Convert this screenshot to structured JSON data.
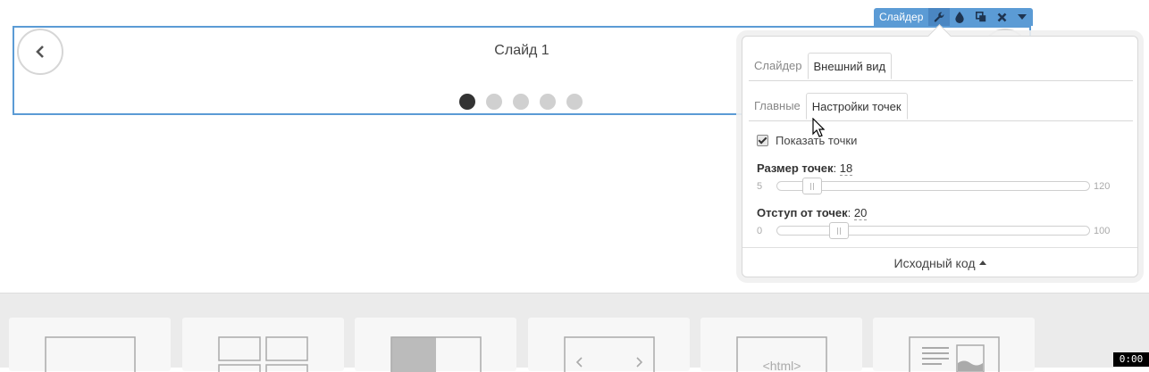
{
  "slider": {
    "toolbar_label": "Слайдер",
    "toolbar_icons": [
      "wrench-icon",
      "drop-icon",
      "duplicate-icon",
      "close-icon",
      "caret-down-icon"
    ],
    "slide_title": "Слайд 1",
    "dots_count": 5,
    "active_dot": 1,
    "accent_color": "#5b9bd5"
  },
  "panel": {
    "tabs_top": [
      "Слайдер",
      "Внешний вид"
    ],
    "tabs_top_active": "Внешний вид",
    "tabs_sub": [
      "Главные",
      "Настройки точек"
    ],
    "tabs_sub_active": "Настройки точек",
    "show_dots_label": "Показать точки",
    "show_dots_checked": true,
    "dot_size": {
      "label": "Размер точек",
      "value": "18",
      "min": "5",
      "max": "120"
    },
    "dot_offset": {
      "label": "Отступ от точек",
      "value": "20",
      "min": "0",
      "max": "100"
    },
    "footer_label": "Исходный код"
  },
  "palette": {
    "blocks": [
      "blank-block-icon",
      "grid-block-icon",
      "image-text-block-icon",
      "slider-block-icon",
      "html-block-icon",
      "text-image-block-icon"
    ],
    "html_label": "<html>"
  },
  "timer": "0:00"
}
